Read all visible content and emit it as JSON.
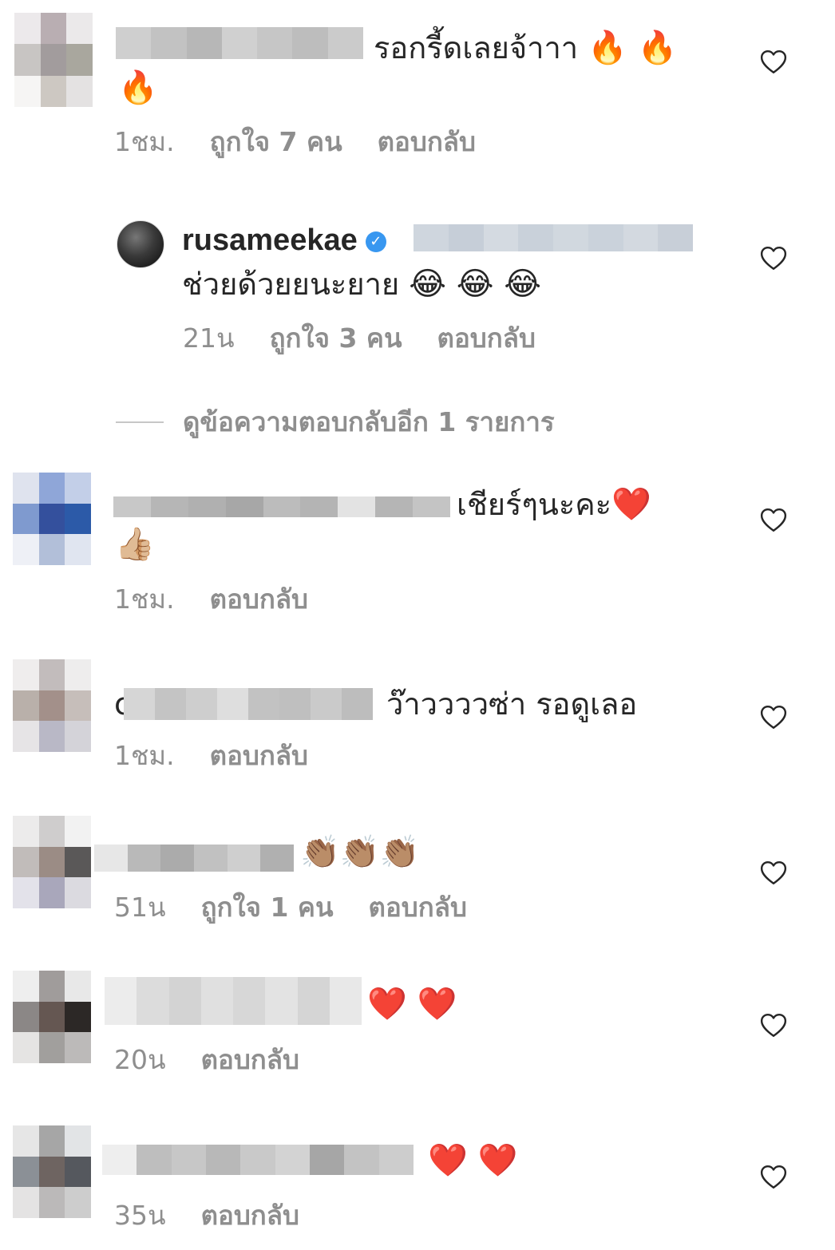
{
  "comments": [
    {
      "text": "รอกรี้ดเลยจ้าาา",
      "emoji_line1": "🔥 🔥",
      "emoji_line2": "🔥",
      "time": "1ชม.",
      "likes": "ถูกใจ 7 คน",
      "reply": "ตอบกลับ"
    },
    {
      "username": "rusameekae",
      "text": "ช่วยด้วยยนะยาย",
      "emoji": "😂 😂 😂",
      "time": "21น",
      "likes": "ถูกใจ 3 คน",
      "reply": "ตอบกลับ"
    },
    {
      "text": "เชียร์ๆนะคะ",
      "emoji_line1": "❤️",
      "emoji_line2": "👍🏼",
      "time": "1ชม.",
      "reply": "ตอบกลับ"
    },
    {
      "prefix": "c",
      "text": "ว๊าววววซ่า รอดูเลอ",
      "time": "1ชม.",
      "reply": "ตอบกลับ"
    },
    {
      "emoji": "👏🏽👏🏽👏🏽",
      "time": "51น",
      "likes": "ถูกใจ 1 คน",
      "reply": "ตอบกลับ"
    },
    {
      "emoji": "❤️ ❤️",
      "time": "20น",
      "reply": "ตอบกลับ"
    },
    {
      "emoji": "❤️ ❤️",
      "time": "35น",
      "reply": "ตอบกลับ"
    }
  ],
  "view_more_replies": "ดูข้อความตอบกลับอีก 1 รายการ",
  "verified_glyph": "✓",
  "icons": {
    "like": "heart-outline-icon",
    "verified": "verified-badge-icon"
  },
  "colors": {
    "text": "#262626",
    "meta": "#8e8e8e",
    "verified": "#3897f0"
  }
}
